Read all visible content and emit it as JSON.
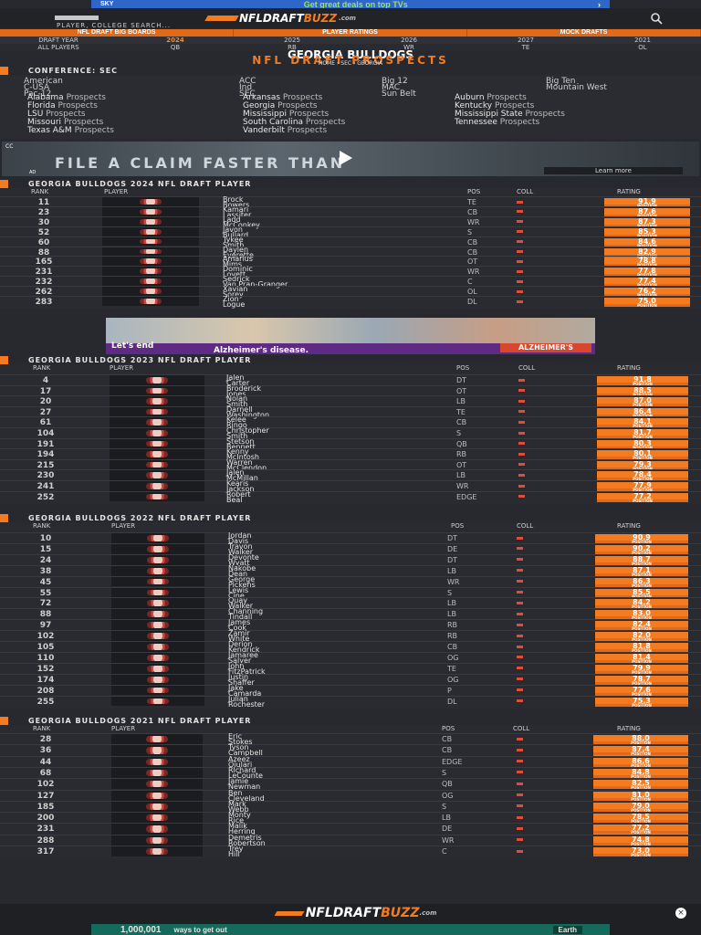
{
  "ad_top": {
    "brand": "SKY",
    "text": "Get great deals on top TVs"
  },
  "header": {
    "logo_main": "NFLDRAFT",
    "logo_accent": "BUZZ",
    "logo_suffix": ".com",
    "search_label": "PLAYER, COLLEGE SEARCH..."
  },
  "nav": [
    "NFL DRAFT BIG BOARDS",
    "PLAYER RATINGS",
    "MOCK DRAFTS"
  ],
  "years": [
    "DRAFT YEAR",
    "2024",
    "2025",
    "2026",
    "2027",
    "2021"
  ],
  "years_active": "2024",
  "positions": [
    "ALL PLAYERS",
    "QB",
    "RB",
    "WR",
    "TE",
    "OL"
  ],
  "page": {
    "title": "GEORGIA BULLDOGS",
    "subtitle": "NFL DRAFT PROSPECTS",
    "breadcrumb": "HOME  ›  SEC  ›  GEORGIA"
  },
  "conference": {
    "heading": "CONFERENCE: SEC",
    "groups": [
      "American",
      "ACC",
      "Big 12",
      "Big Ten",
      "C-USA",
      "Ind",
      "MAC",
      "Mountain West",
      "Pac-12",
      "SEC",
      "Sun Belt"
    ],
    "teams": [
      [
        "Alabama",
        "Arkansas",
        "Auburn"
      ],
      [
        "Florida",
        "Georgia",
        "Kentucky"
      ],
      [
        "LSU",
        "Mississippi",
        "Mississippi State"
      ],
      [
        "Missouri",
        "South Carolina",
        "Tennessee"
      ],
      [
        "Texas A&M",
        "Vanderbilt",
        ""
      ]
    ],
    "prospect_suffix": "Prospects"
  },
  "video_ad": {
    "caption": "FILE A CLAIM FASTER THAN",
    "cta": "Learn more",
    "cc": "CC",
    "label": "AD"
  },
  "ad_mid": {
    "line1": "Let's end",
    "line2": "Alzheimer's disease.",
    "brand": "ALZHEIMER'S"
  },
  "table_labels": {
    "rank": "RANK",
    "player": "PLAYER",
    "pos": "POS",
    "coll": "COLL",
    "rating": "RATING",
    "rating_sub": "POSITION"
  },
  "tables": [
    {
      "heading": "GEORGIA BULLDOGS 2024 NFL DRAFT PLAYER",
      "rows": [
        {
          "rank": "11",
          "first": "Brock",
          "last": "Bowers",
          "pos": "TE",
          "rating": "91.9"
        },
        {
          "rank": "23",
          "first": "Kamari",
          "last": "Lassiter",
          "pos": "CB",
          "rating": "87.6"
        },
        {
          "rank": "30",
          "first": "Ladd",
          "last": "McConkey",
          "pos": "WR",
          "rating": "87.3"
        },
        {
          "rank": "52",
          "first": "Javon",
          "last": "Bullard",
          "pos": "S",
          "rating": "85.3"
        },
        {
          "rank": "60",
          "first": "Tykee",
          "last": "Smith",
          "pos": "CB",
          "rating": "84.6"
        },
        {
          "rank": "88",
          "first": "Daylen",
          "last": "Everette",
          "pos": "CB",
          "rating": "82.9"
        },
        {
          "rank": "165",
          "first": "Amarius",
          "last": "Mims",
          "pos": "OT",
          "rating": "78.8"
        },
        {
          "rank": "231",
          "first": "Dominic",
          "last": "Lovett",
          "pos": "WR",
          "rating": "77.8"
        },
        {
          "rank": "232",
          "first": "Sedrick",
          "last": "Van Pran-Granger",
          "pos": "C",
          "rating": "77.4"
        },
        {
          "rank": "262",
          "first": "Xavian",
          "last": "Sorey",
          "pos": "OL",
          "rating": "76.2"
        },
        {
          "rank": "283",
          "first": "Zion",
          "last": "Logue",
          "pos": "DL",
          "rating": "75.0"
        }
      ]
    },
    {
      "heading": "GEORGIA BULLDOGS 2023 NFL DRAFT PLAYER",
      "rows": [
        {
          "rank": "4",
          "first": "Jalen",
          "last": "Carter",
          "pos": "DT",
          "rating": "91.8"
        },
        {
          "rank": "17",
          "first": "Broderick",
          "last": "Jones",
          "pos": "OT",
          "rating": "88.5"
        },
        {
          "rank": "20",
          "first": "Nolan",
          "last": "Smith",
          "pos": "LB",
          "rating": "87.0"
        },
        {
          "rank": "27",
          "first": "Darnell",
          "last": "Washington",
          "pos": "TE",
          "rating": "86.4"
        },
        {
          "rank": "61",
          "first": "Kelee",
          "last": "Ringo",
          "pos": "CB",
          "rating": "84.1"
        },
        {
          "rank": "104",
          "first": "Christopher",
          "last": "Smith",
          "pos": "S",
          "rating": "81.7"
        },
        {
          "rank": "191",
          "first": "Stetson",
          "last": "Bennett",
          "pos": "QB",
          "rating": "80.3"
        },
        {
          "rank": "194",
          "first": "Kenny",
          "last": "McIntosh",
          "pos": "RB",
          "rating": "80.1"
        },
        {
          "rank": "215",
          "first": "Warren",
          "last": "McClendon",
          "pos": "OT",
          "rating": "79.3"
        },
        {
          "rank": "230",
          "first": "Jalen",
          "last": "McMillan",
          "pos": "LB",
          "rating": "78.4"
        },
        {
          "rank": "241",
          "first": "Kearis",
          "last": "Jackson",
          "pos": "WR",
          "rating": "77.9"
        },
        {
          "rank": "252",
          "first": "Robert",
          "last": "Beal",
          "pos": "EDGE",
          "rating": "77.2"
        }
      ]
    },
    {
      "heading": "GEORGIA BULLDOGS 2022 NFL DRAFT PLAYER",
      "rows": [
        {
          "rank": "10",
          "first": "Jordan",
          "last": "Davis",
          "pos": "DT",
          "rating": "90.9"
        },
        {
          "rank": "15",
          "first": "Travon",
          "last": "Walker",
          "pos": "DE",
          "rating": "90.2"
        },
        {
          "rank": "24",
          "first": "Devonte",
          "last": "Wyatt",
          "pos": "DT",
          "rating": "88.7"
        },
        {
          "rank": "38",
          "first": "Nakobe",
          "last": "Dean",
          "pos": "LB",
          "rating": "87.1"
        },
        {
          "rank": "45",
          "first": "George",
          "last": "Pickens",
          "pos": "WR",
          "rating": "86.3"
        },
        {
          "rank": "55",
          "first": "Lewis",
          "last": "Cine",
          "pos": "S",
          "rating": "85.5"
        },
        {
          "rank": "72",
          "first": "Quay",
          "last": "Walker",
          "pos": "LB",
          "rating": "84.2"
        },
        {
          "rank": "88",
          "first": "Channing",
          "last": "Tindall",
          "pos": "LB",
          "rating": "83.0"
        },
        {
          "rank": "97",
          "first": "James",
          "last": "Cook",
          "pos": "RB",
          "rating": "82.4"
        },
        {
          "rank": "102",
          "first": "Zamir",
          "last": "White",
          "pos": "RB",
          "rating": "82.0"
        },
        {
          "rank": "105",
          "first": "Derion",
          "last": "Kendrick",
          "pos": "CB",
          "rating": "81.8"
        },
        {
          "rank": "110",
          "first": "Jamaree",
          "last": "Salyer",
          "pos": "OG",
          "rating": "81.4"
        },
        {
          "rank": "152",
          "first": "John",
          "last": "FitzPatrick",
          "pos": "TE",
          "rating": "79.9"
        },
        {
          "rank": "174",
          "first": "Justin",
          "last": "Shaffer",
          "pos": "OG",
          "rating": "78.7"
        },
        {
          "rank": "208",
          "first": "Jake",
          "last": "Camarda",
          "pos": "P",
          "rating": "77.6"
        },
        {
          "rank": "255",
          "first": "Julian",
          "last": "Rochester",
          "pos": "DL",
          "rating": "75.3"
        }
      ]
    },
    {
      "heading": "GEORGIA BULLDOGS 2021 NFL DRAFT PLAYER",
      "rows": [
        {
          "rank": "28",
          "first": "Eric",
          "last": "Stokes",
          "pos": "CB",
          "rating": "88.0"
        },
        {
          "rank": "36",
          "first": "Tyson",
          "last": "Campbell",
          "pos": "CB",
          "rating": "87.4"
        },
        {
          "rank": "44",
          "first": "Azeez",
          "last": "Ojulari",
          "pos": "EDGE",
          "rating": "86.6"
        },
        {
          "rank": "68",
          "first": "Richard",
          "last": "LeCounte",
          "pos": "S",
          "rating": "84.8"
        },
        {
          "rank": "102",
          "first": "Jamie",
          "last": "Newman",
          "pos": "QB",
          "rating": "82.5"
        },
        {
          "rank": "127",
          "first": "Ben",
          "last": "Cleveland",
          "pos": "OG",
          "rating": "81.0"
        },
        {
          "rank": "185",
          "first": "Mark",
          "last": "Webb",
          "pos": "S",
          "rating": "79.0"
        },
        {
          "rank": "200",
          "first": "Monty",
          "last": "Rice",
          "pos": "LB",
          "rating": "78.5"
        },
        {
          "rank": "231",
          "first": "Malik",
          "last": "Herring",
          "pos": "DE",
          "rating": "77.2"
        },
        {
          "rank": "288",
          "first": "Demetris",
          "last": "Robertson",
          "pos": "WR",
          "rating": "74.8"
        },
        {
          "rank": "317",
          "first": "Trey",
          "last": "Hill",
          "pos": "C",
          "rating": "73.0"
        }
      ]
    }
  ],
  "footer": {
    "logo_main": "NFLDRAFT",
    "logo_accent": "BUZZ",
    "logo_suffix": ".com",
    "close": "×"
  },
  "ad_bottom": {
    "big": "1,000,001",
    "text": "ways to get out",
    "cta": "Earth"
  }
}
